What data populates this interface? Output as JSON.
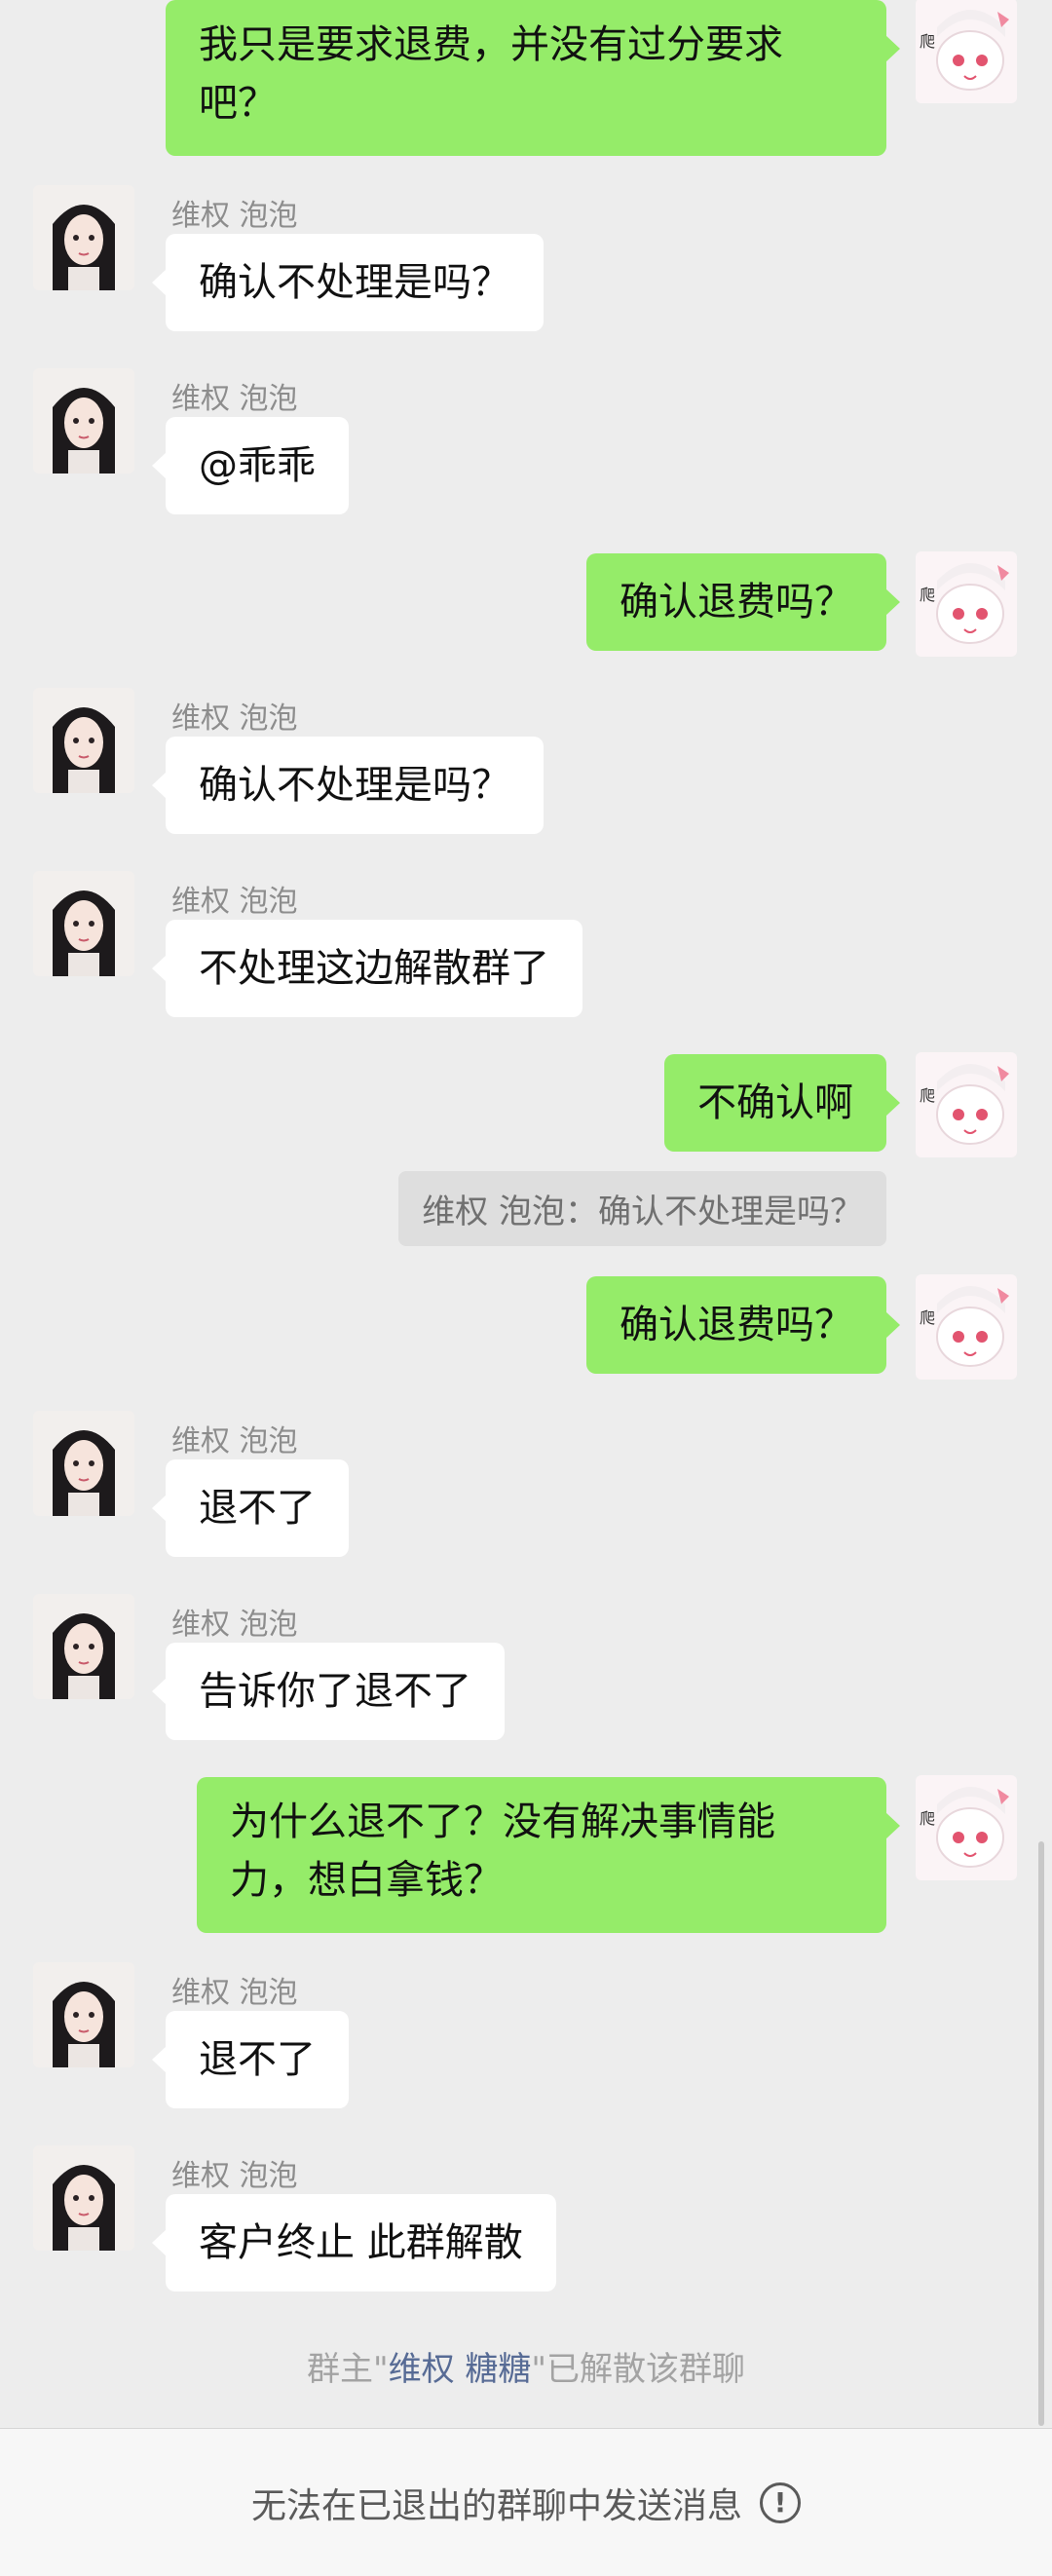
{
  "messages": [
    {
      "side": "out",
      "text": "我只是要求退费，并没有过分要求\n吧？"
    },
    {
      "side": "in",
      "sender": "维权 泡泡",
      "text": "确认不处理是吗？"
    },
    {
      "side": "in",
      "sender": "维权 泡泡",
      "text": "@乖乖"
    },
    {
      "side": "out",
      "text": "确认退费吗？"
    },
    {
      "side": "in",
      "sender": "维权 泡泡",
      "text": "确认不处理是吗？"
    },
    {
      "side": "in",
      "sender": "维权 泡泡",
      "text": "不处理这边解散群了"
    },
    {
      "side": "out",
      "text": "不确认啊"
    },
    {
      "side": "quote",
      "text": "维权 泡泡：确认不处理是吗？"
    },
    {
      "side": "out",
      "text": "确认退费吗？"
    },
    {
      "side": "in",
      "sender": "维权 泡泡",
      "text": "退不了"
    },
    {
      "side": "in",
      "sender": "维权 泡泡",
      "text": "告诉你了退不了"
    },
    {
      "side": "out",
      "text": "为什么退不了？没有解决事情能\n力，想白拿钱？"
    },
    {
      "side": "in",
      "sender": "维权 泡泡",
      "text": "退不了"
    },
    {
      "side": "in",
      "sender": "维权 泡泡",
      "text": "客户终止 此群解散"
    }
  ],
  "system_notice": {
    "prefix": "群主\"",
    "owner": "维权 糖糖",
    "suffix": "\"已解散该群聊"
  },
  "footer": {
    "text": "无法在已退出的群聊中发送消息",
    "icon": "info-icon",
    "icon_glyph": "!"
  },
  "colors": {
    "outgoing_bubble": "#95ec69",
    "incoming_bubble": "#ffffff",
    "background": "#ededed",
    "link": "#576b95"
  }
}
